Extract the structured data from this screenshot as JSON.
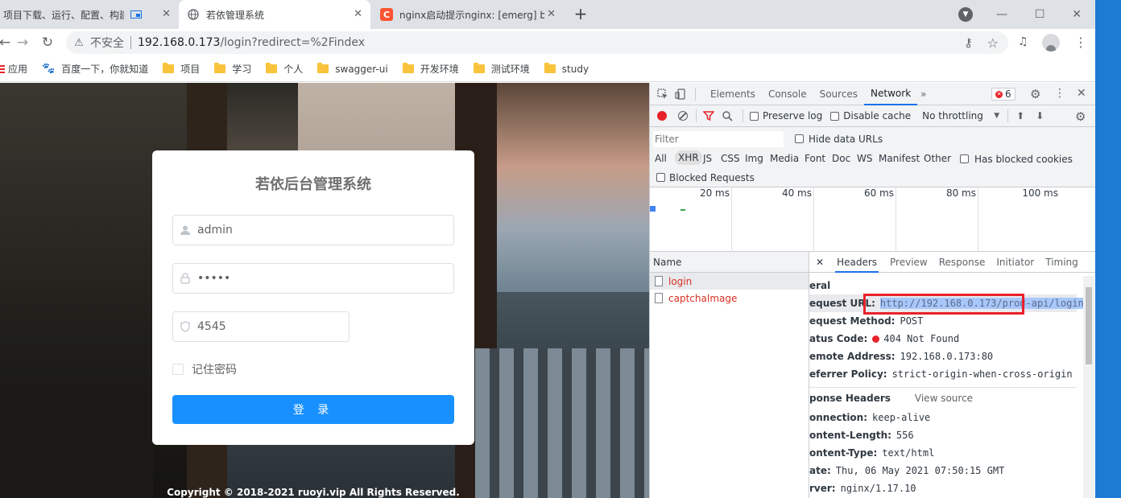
{
  "browser": {
    "tabs": [
      {
        "title": "项目下载、运行、配置、构建"
      },
      {
        "title": "若依管理系统"
      },
      {
        "title": "nginx启动提示nginx: [emerg] b"
      }
    ],
    "address": {
      "security": "不安全",
      "host": "192.168.0.173",
      "path": "/login?redirect=%2Findex"
    },
    "bookmarks": [
      {
        "label": "应用",
        "icon": "apps-icon"
      },
      {
        "label": "百度一下，你就知道",
        "icon": "baidu-icon"
      },
      {
        "label": "项目",
        "icon": "folder-icon"
      },
      {
        "label": "学习",
        "icon": "folder-icon"
      },
      {
        "label": "个人",
        "icon": "folder-icon"
      },
      {
        "label": "swagger-ui",
        "icon": "folder-icon"
      },
      {
        "label": "开发环境",
        "icon": "folder-icon"
      },
      {
        "label": "测试环境",
        "icon": "folder-icon"
      },
      {
        "label": "study",
        "icon": "folder-icon"
      }
    ]
  },
  "login": {
    "title": "若依后台管理系统",
    "username": "admin",
    "password": "•••••",
    "captcha": "4545",
    "remember": "记住密码",
    "button": "登 录",
    "copyright": "Copyright © 2018-2021 ruoyi.vip All Rights Reserved."
  },
  "devtools": {
    "tabs": [
      "Elements",
      "Console",
      "Sources",
      "Network"
    ],
    "active_tab": "Network",
    "error_count": "6",
    "preserve_log": "Preserve log",
    "disable_cache": "Disable cache",
    "throttling": "No throttling",
    "filter_placeholder": "Filter",
    "hide_data_urls": "Hide data URLs",
    "types": [
      "All",
      "XHR",
      "JS",
      "CSS",
      "Img",
      "Media",
      "Font",
      "Doc",
      "WS",
      "Manifest",
      "Other"
    ],
    "has_blocked_cookies": "Has blocked cookies",
    "blocked_requests": "Blocked Requests",
    "timeline_ticks": [
      "20 ms",
      "40 ms",
      "60 ms",
      "80 ms",
      "100 ms"
    ],
    "name_header": "Name",
    "requests": [
      "login",
      "captchaImage"
    ],
    "detail_tabs": [
      "Headers",
      "Preview",
      "Response",
      "Initiator",
      "Timing"
    ],
    "general_title": "eral",
    "general": [
      {
        "key": "equest URL:",
        "value": "http://192.168.0.173/prod-api/login"
      },
      {
        "key": "equest Method:",
        "value": "POST"
      },
      {
        "key": "atus Code:",
        "value": "404 Not Found"
      },
      {
        "key": "emote Address:",
        "value": "192.168.0.173:80"
      },
      {
        "key": "eferrer Policy:",
        "value": "strict-origin-when-cross-origin"
      }
    ],
    "response_headers_title": "ponse Headers",
    "view_source": "View source",
    "response_headers": [
      {
        "key": "onnection:",
        "value": "keep-alive"
      },
      {
        "key": "ontent-Length:",
        "value": "556"
      },
      {
        "key": "ontent-Type:",
        "value": "text/html"
      },
      {
        "key": "ate:",
        "value": "Thu, 06 May 2021 07:50:15 GMT"
      },
      {
        "key": "rver:",
        "value": "nginx/1.17.10"
      }
    ]
  },
  "colors": {
    "accent": "#1890ff",
    "error": "#e8222a",
    "devtools_link": "#1a73e8"
  }
}
